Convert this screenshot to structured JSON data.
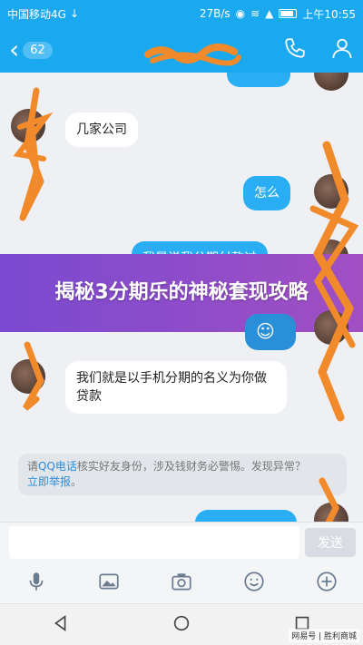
{
  "status_bar": {
    "carrier": "中国移动4G",
    "speed": "27B/s",
    "time": "上午10:55"
  },
  "header": {
    "unread_count": "62",
    "contact_name": "—",
    "icons": [
      "back-chevron-icon",
      "phone-icon",
      "profile-icon"
    ]
  },
  "messages": [
    {
      "side": "in",
      "text": "几家公司"
    },
    {
      "side": "out",
      "text": "怎么"
    },
    {
      "side": "out",
      "text": "我是说我分期付款过"
    },
    {
      "side": "in",
      "text": "我们就是以手机分期的名义为你做贷款"
    }
  ],
  "banner": {
    "text": "揭秘3分期乐的神秘套现攻略"
  },
  "notice": {
    "prefix": "请",
    "link1": "QQ电话",
    "body": "核实好友身份，涉及钱财务必警惕。发现异常？",
    "link2": "立即举报",
    "suffix": "。"
  },
  "input": {
    "send_label": "发送"
  },
  "toolbar": {
    "icons": [
      "microphone-icon",
      "image-icon",
      "camera-icon",
      "emoji-icon",
      "plus-icon"
    ]
  },
  "navbar": {
    "icons": [
      "nav-back-icon",
      "nav-home-icon",
      "nav-recents-icon"
    ]
  },
  "watermark": "网易号 | 胜利商城",
  "colors": {
    "accent": "#1aa8ef",
    "bubble_out": "#2aaef3",
    "banner": "#8a4cd0",
    "scribble": "#f08a2a"
  }
}
